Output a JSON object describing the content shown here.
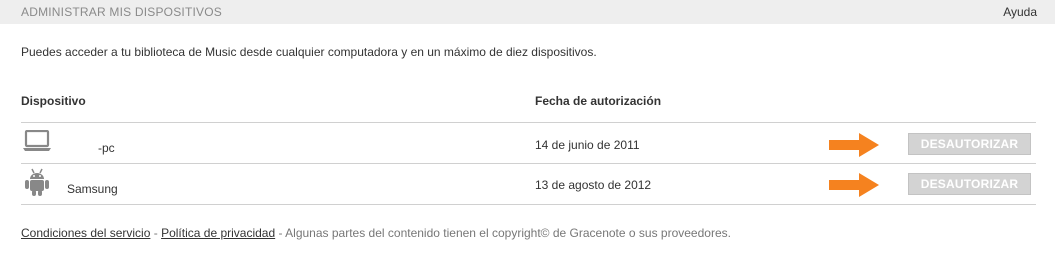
{
  "header": {
    "title": "ADMINISTRAR MIS DISPOSITIVOS",
    "help_label": "Ayuda"
  },
  "intro_text": "Puedes acceder a tu biblioteca de Music desde cualquier computadora y en un máximo de diez dispositivos.",
  "table": {
    "columns": [
      "Dispositivo",
      "Fecha de autorización"
    ],
    "rows": [
      {
        "icon": "laptop-icon",
        "name": "-pc",
        "date": "14 de junio de 2011",
        "action_label": "DESAUTORIZAR"
      },
      {
        "icon": "android-icon",
        "name": "Samsung",
        "date": "13 de agosto de 2012",
        "action_label": "DESAUTORIZAR"
      }
    ]
  },
  "footer": {
    "terms_label": "Condiciones del servicio",
    "separator": " - ",
    "privacy_label": "Política de privacidad",
    "copyright_text": " - Algunas partes del contenido tienen el copyright© de Gracenote o sus proveedores."
  },
  "colors": {
    "header_bg": "#eeeeee",
    "arrow": "#f5821f",
    "button_bg": "#d3d3d3"
  }
}
